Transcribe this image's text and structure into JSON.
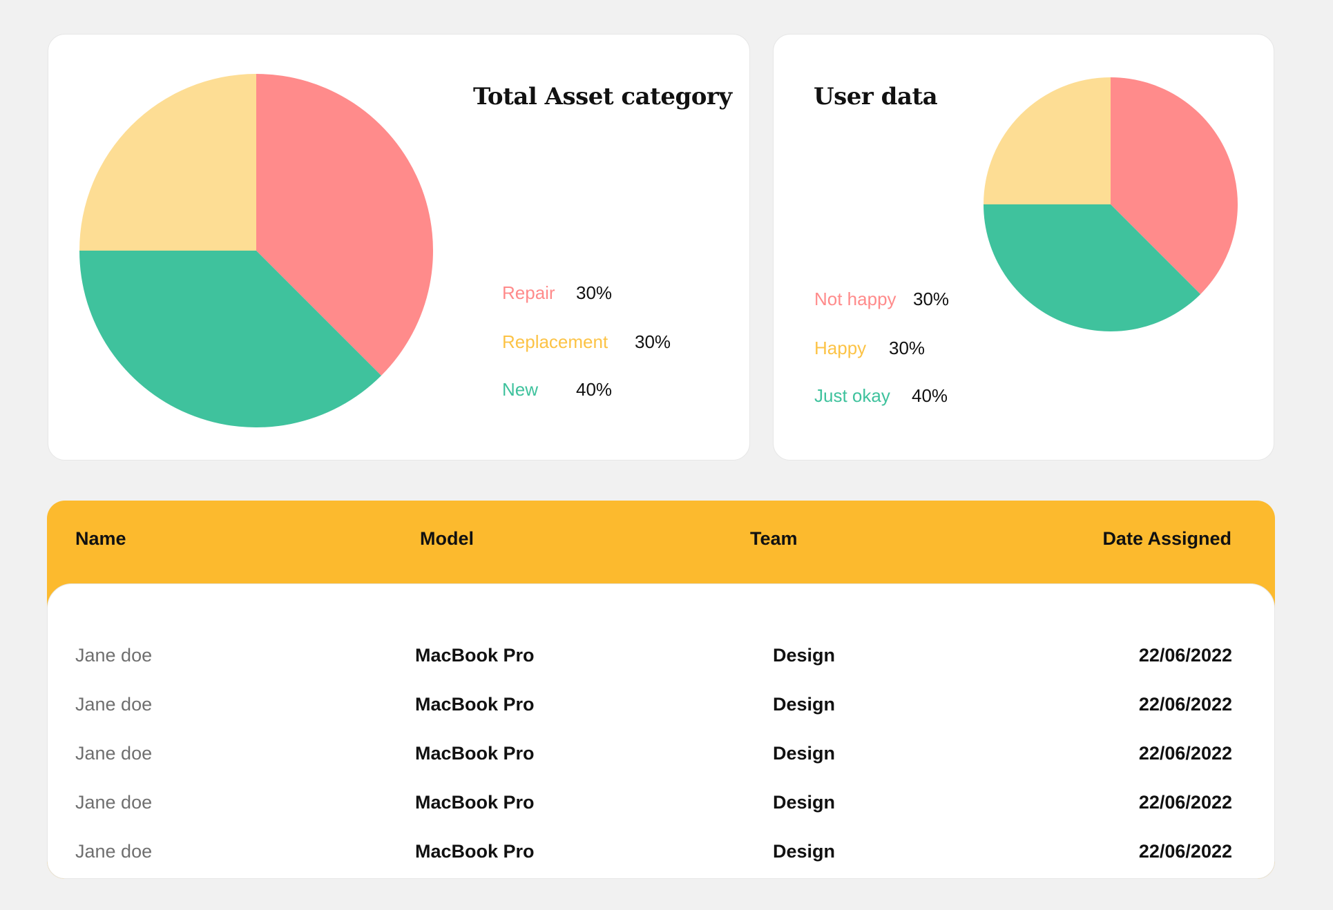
{
  "asset_card": {
    "title": "Total Asset category",
    "legend": [
      {
        "label": "Repair",
        "value": "30%",
        "color": "#ff8b8b"
      },
      {
        "label": "Replacement",
        "value": "30%",
        "color": "#fcc346"
      },
      {
        "label": "New",
        "value": "40%",
        "color": "#3fc29d"
      }
    ]
  },
  "user_card": {
    "title": "User data",
    "legend": [
      {
        "label": "Not happy",
        "value": "30%",
        "color": "#ff8b8b"
      },
      {
        "label": "Happy",
        "value": "30%",
        "color": "#fcc346"
      },
      {
        "label": "Just okay",
        "value": "40%",
        "color": "#3fc29d"
      }
    ]
  },
  "chart_data": [
    {
      "type": "pie",
      "title": "Total Asset category",
      "categories": [
        "Repair",
        "New",
        "Replacement"
      ],
      "values": [
        37.5,
        37.5,
        25
      ],
      "colors": [
        "#ff8b8b",
        "#3fc29d",
        "#fddd94"
      ]
    },
    {
      "type": "pie",
      "title": "User data",
      "categories": [
        "Not happy",
        "Just okay",
        "Happy"
      ],
      "values": [
        37.5,
        37.5,
        25
      ],
      "colors": [
        "#ff8b8b",
        "#3fc29d",
        "#fddd94"
      ]
    }
  ],
  "table": {
    "headers": [
      "Name",
      "Model",
      "Team",
      "Date Assigned"
    ],
    "rows": [
      [
        "Jane doe",
        "MacBook Pro",
        "Design",
        "22/06/2022"
      ],
      [
        "Jane doe",
        "MacBook Pro",
        "Design",
        "22/06/2022"
      ],
      [
        "Jane doe",
        "MacBook Pro",
        "Design",
        "22/06/2022"
      ],
      [
        "Jane doe",
        "MacBook Pro",
        "Design",
        "22/06/2022"
      ],
      [
        "Jane doe",
        "MacBook Pro",
        "Design",
        "22/06/2022"
      ]
    ],
    "header_color": "#fcba2e"
  }
}
